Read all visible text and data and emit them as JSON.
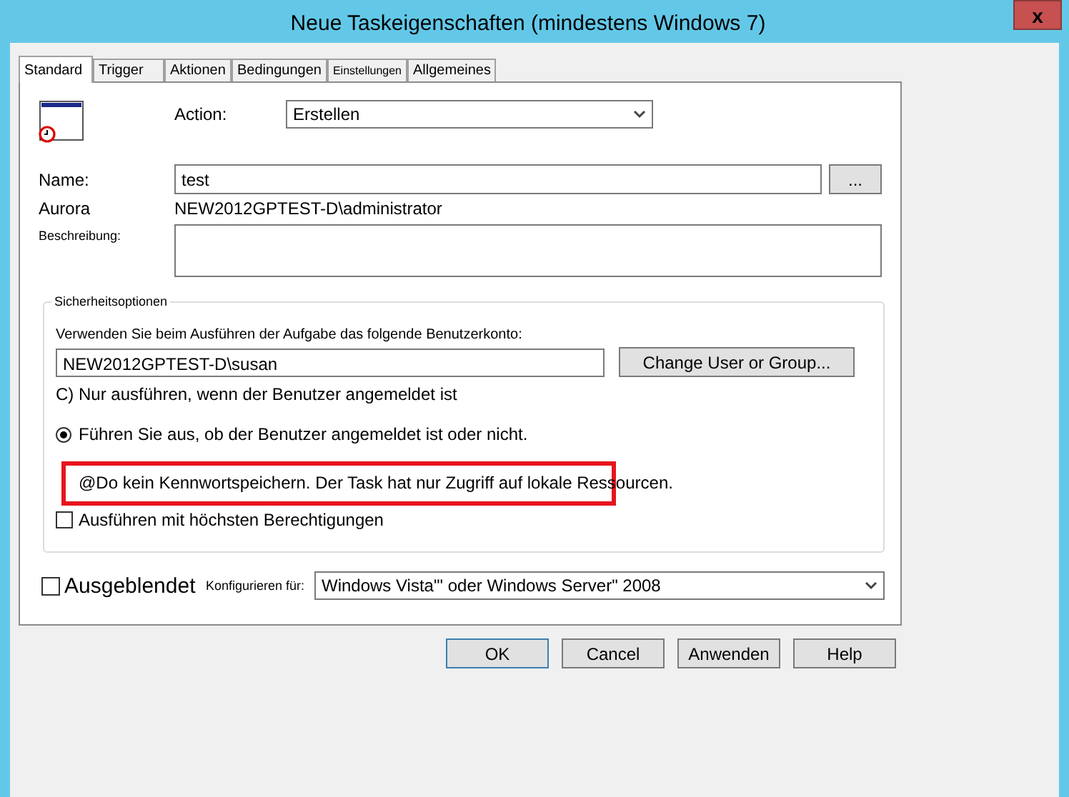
{
  "window": {
    "title": "Neue Taskeigenschaften (mindestens Windows 7)",
    "close": "x"
  },
  "tabs": [
    {
      "label": "Standard",
      "selected": true
    },
    {
      "label": "Trigger",
      "selected": false
    },
    {
      "label": "Aktionen",
      "selected": false
    },
    {
      "label": "Bedingungen",
      "selected": false
    },
    {
      "label": "Einstellungen",
      "selected": false
    },
    {
      "label": "Allgemeines",
      "selected": false
    }
  ],
  "action": {
    "label": "Action:",
    "value": "Erstellen"
  },
  "name": {
    "label": "Name:",
    "value": "test",
    "browse": "..."
  },
  "author": {
    "label": "Aurora",
    "value": "NEW2012GPTEST-D\\administrator"
  },
  "description": {
    "label": "Beschreibung:"
  },
  "security": {
    "title": "Sicherheitsoptionen",
    "account_label": "Verwenden Sie beim Ausführen der Aufgabe das folgende Benutzerkonto:",
    "account": "NEW2012GPTEST-D\\susan",
    "change_button": "Change User or Group...",
    "logged_on_text": "C) Nur ausführen, wenn der Benutzer angemeldet ist",
    "radio": {
      "label": "Führen Sie aus, ob der Benutzer angemeldet ist oder nicht.",
      "selected": true
    },
    "note": {
      "text": "@Do kein Kennwortspeichern. Der Task hat nur Zugriff auf lokale Ressourcen.",
      "highlighted": true
    },
    "highest": {
      "label": "Ausführen mit höchsten Berechtigungen",
      "checked": false
    }
  },
  "hidden": {
    "label": "Ausgeblendet",
    "checked": false
  },
  "configure": {
    "label": "Konfigurieren für:",
    "value": "Windows Vista\"' oder Windows Server\" 2008"
  },
  "buttons": [
    {
      "label": "OK",
      "default": true
    },
    {
      "label": "Cancel",
      "default": false
    },
    {
      "label": "Anwenden",
      "default": false
    },
    {
      "label": "Help",
      "default": false
    }
  ]
}
